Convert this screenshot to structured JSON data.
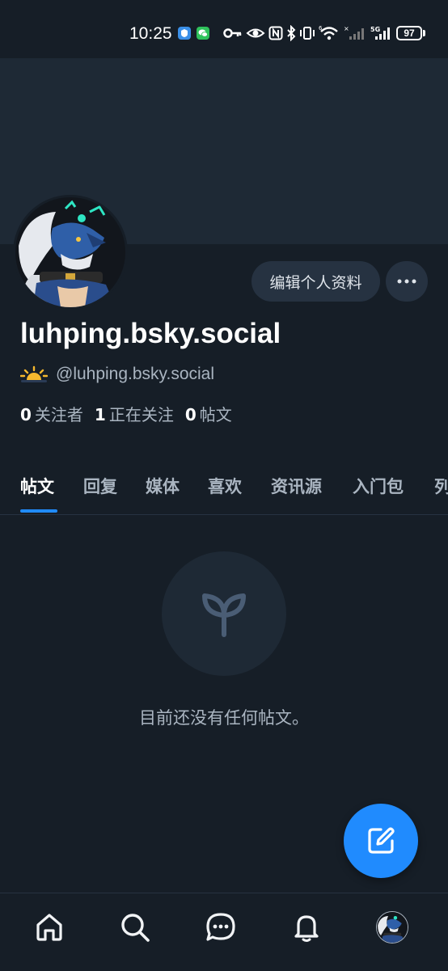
{
  "status_bar": {
    "time": "10:25",
    "battery": "97",
    "network": "5G",
    "wifi_label": "6",
    "icons": [
      "shield-app-icon",
      "wechat-icon",
      "key-icon",
      "eye-icon",
      "nfc-icon",
      "bluetooth-icon",
      "vibrate-icon",
      "wifi-icon",
      "signal-icon",
      "battery-icon"
    ]
  },
  "profile": {
    "display_name": "luhping.bsky.social",
    "handle": "@luhping.bsky.social",
    "edit_button": "编辑个人资料",
    "more_button": "more-icon",
    "stats": {
      "followers_count": "0",
      "followers_label": "关注者",
      "following_count": "1",
      "following_label": "正在关注",
      "posts_count": "0",
      "posts_label": "帖文"
    }
  },
  "tabs": [
    {
      "label": "帖文",
      "active": true
    },
    {
      "label": "回复",
      "active": false
    },
    {
      "label": "媒体",
      "active": false
    },
    {
      "label": "喜欢",
      "active": false
    },
    {
      "label": "资讯源",
      "active": false
    },
    {
      "label": "入门包",
      "active": false
    },
    {
      "label": "列",
      "active": false
    }
  ],
  "empty_state": {
    "icon": "sprout-icon",
    "text": "目前还没有任何帖文。"
  },
  "fab": {
    "icon": "compose-icon"
  },
  "bottom_nav": [
    "home-icon",
    "search-icon",
    "chat-icon",
    "bell-icon",
    "profile-avatar"
  ],
  "colors": {
    "background": "#161e27",
    "banner": "#1e2935",
    "button": "#263241",
    "accent": "#208bfe",
    "muted_text": "#aab5c1"
  }
}
